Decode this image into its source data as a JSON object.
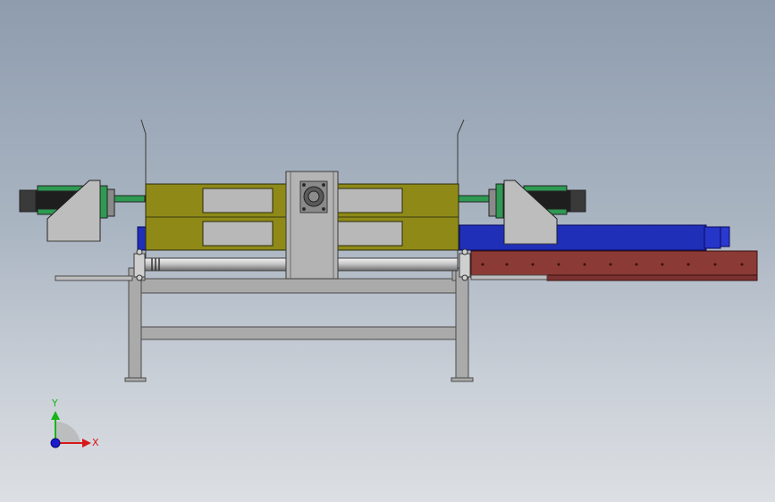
{
  "triad": {
    "y_label": "Y",
    "x_label": "X",
    "y_color": "#18b418",
    "x_color": "#d81818",
    "z_color": "#1a1ad0"
  },
  "colors": {
    "frame": "#a9aaa9",
    "frame_edge": "#4a4a4a",
    "beam": "#8f8a18",
    "cylinder_green": "#2e9a52",
    "blue_actuator": "#1f2fb8",
    "rail": "#8b3a35",
    "bracket": "#b9b9b9",
    "shaft": "#d0d0d0"
  }
}
